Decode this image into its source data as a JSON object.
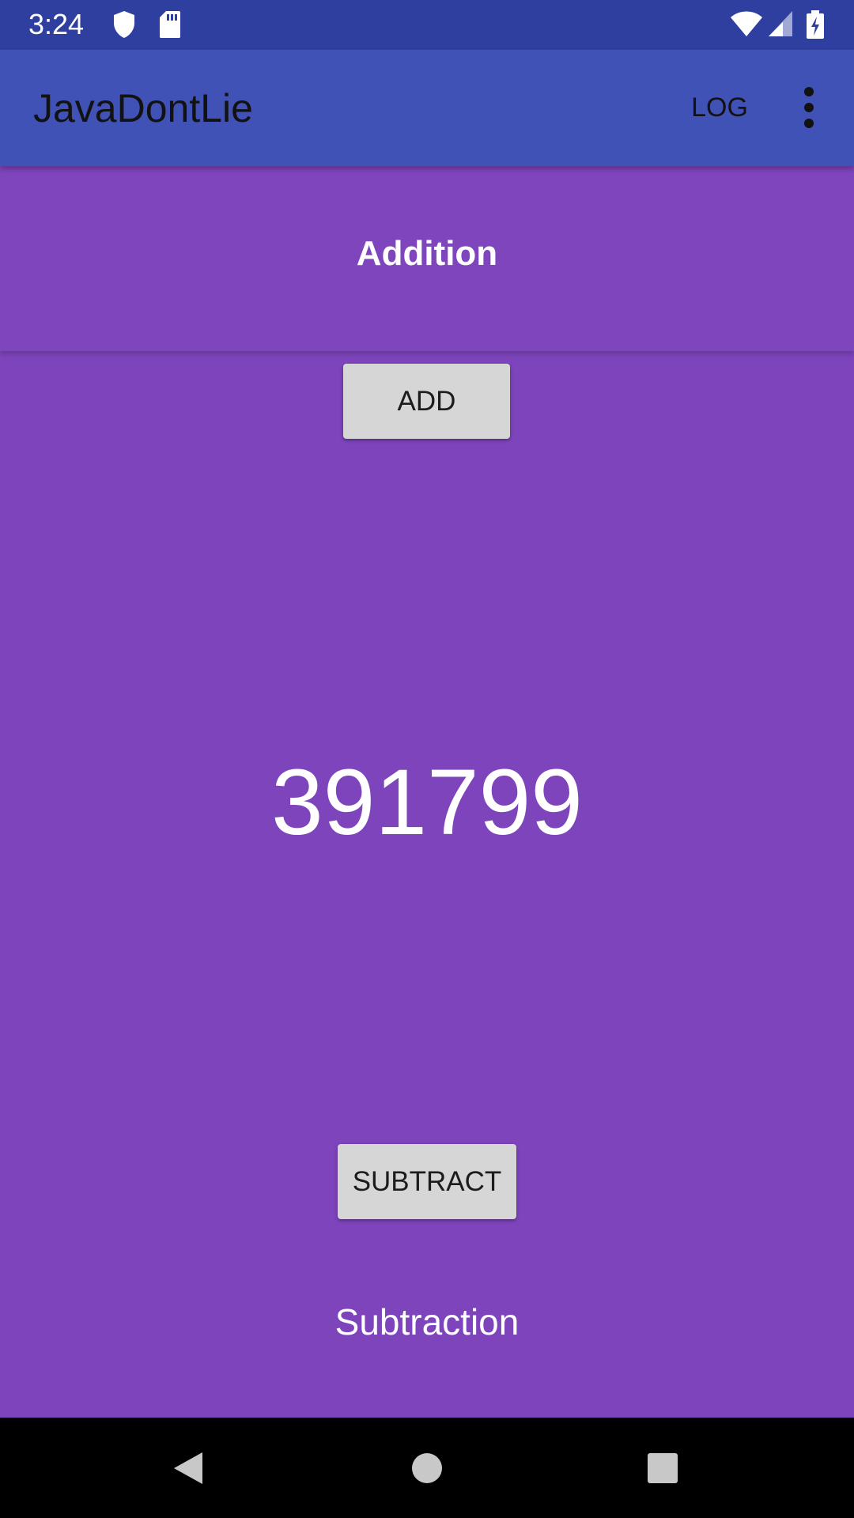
{
  "status_bar": {
    "time": "3:24",
    "icons": [
      "shield-icon",
      "sd-card-icon",
      "wifi-icon",
      "signal-icon",
      "battery-charging-icon"
    ]
  },
  "app_bar": {
    "title": "JavaDontLie",
    "log_label": "LOG",
    "overflow_icon": "more-vert-icon"
  },
  "main": {
    "section_title": "Addition",
    "add_label": "ADD",
    "result": "391799",
    "subtract_label": "SUBTRACT",
    "footer_label": "Subtraction"
  },
  "nav_bar": {
    "icons": [
      "back-icon",
      "home-icon",
      "recents-icon"
    ]
  },
  "colors": {
    "status_bar": "#2F3F9F",
    "app_bar": "#4152B6",
    "content_background": "#7D44BC",
    "button": "#D6D6D6"
  }
}
